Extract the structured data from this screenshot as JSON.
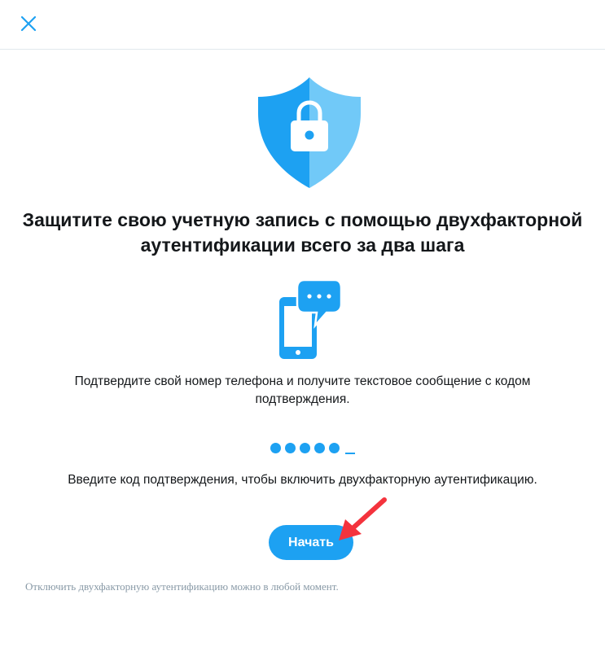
{
  "header": {
    "close_icon": "close-icon"
  },
  "hero": {
    "icon": "shield-lock-icon",
    "title": "Защитите свою учетную запись с помощью двухфакторной аутентификации всего за два шага"
  },
  "step1": {
    "icon": "phone-chat-icon",
    "text": "Подтвердите свой номер телефона и получите текстовое сообщение с кодом подтверждения."
  },
  "step2": {
    "icon": "code-dots-icon",
    "text": "Введите код подтверждения, чтобы включить двухфакторную аутентификацию."
  },
  "actions": {
    "start_label": "Начать"
  },
  "footer": {
    "note": "Отключить двухфакторную аутентификацию можно в любой момент."
  },
  "colors": {
    "accent": "#1da1f2",
    "accent_light": "#71c9f8",
    "text": "#14171a",
    "muted": "#8899a6",
    "annotation_arrow": "#f4333d"
  }
}
